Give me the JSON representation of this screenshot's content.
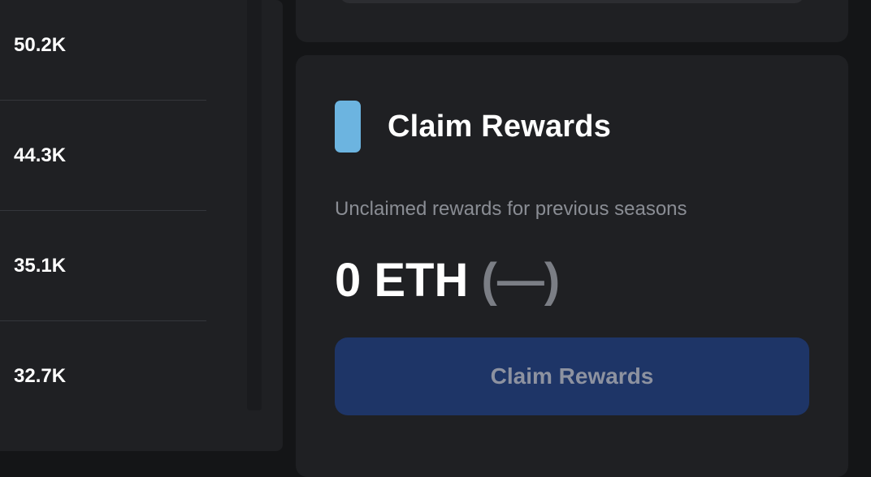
{
  "leaderboard": {
    "rows": [
      {
        "value": "50.2K"
      },
      {
        "value": "44.3K"
      },
      {
        "value": "35.1K"
      },
      {
        "value": "32.7K"
      }
    ]
  },
  "claim": {
    "title": "Claim Rewards",
    "subtitle": "Unclaimed rewards for previous seasons",
    "amount": "0 ETH",
    "fiat": "(—)",
    "button_label": "Claim Rewards",
    "button_disabled": true,
    "icon": "claim-rewards-icon"
  },
  "colors": {
    "background": "#141517",
    "card": "#1f2023",
    "accent_icon": "#6cb4e0",
    "button_bg": "#1e3567",
    "button_text_disabled": "#8d92a0",
    "muted_text": "#8a8d94"
  }
}
